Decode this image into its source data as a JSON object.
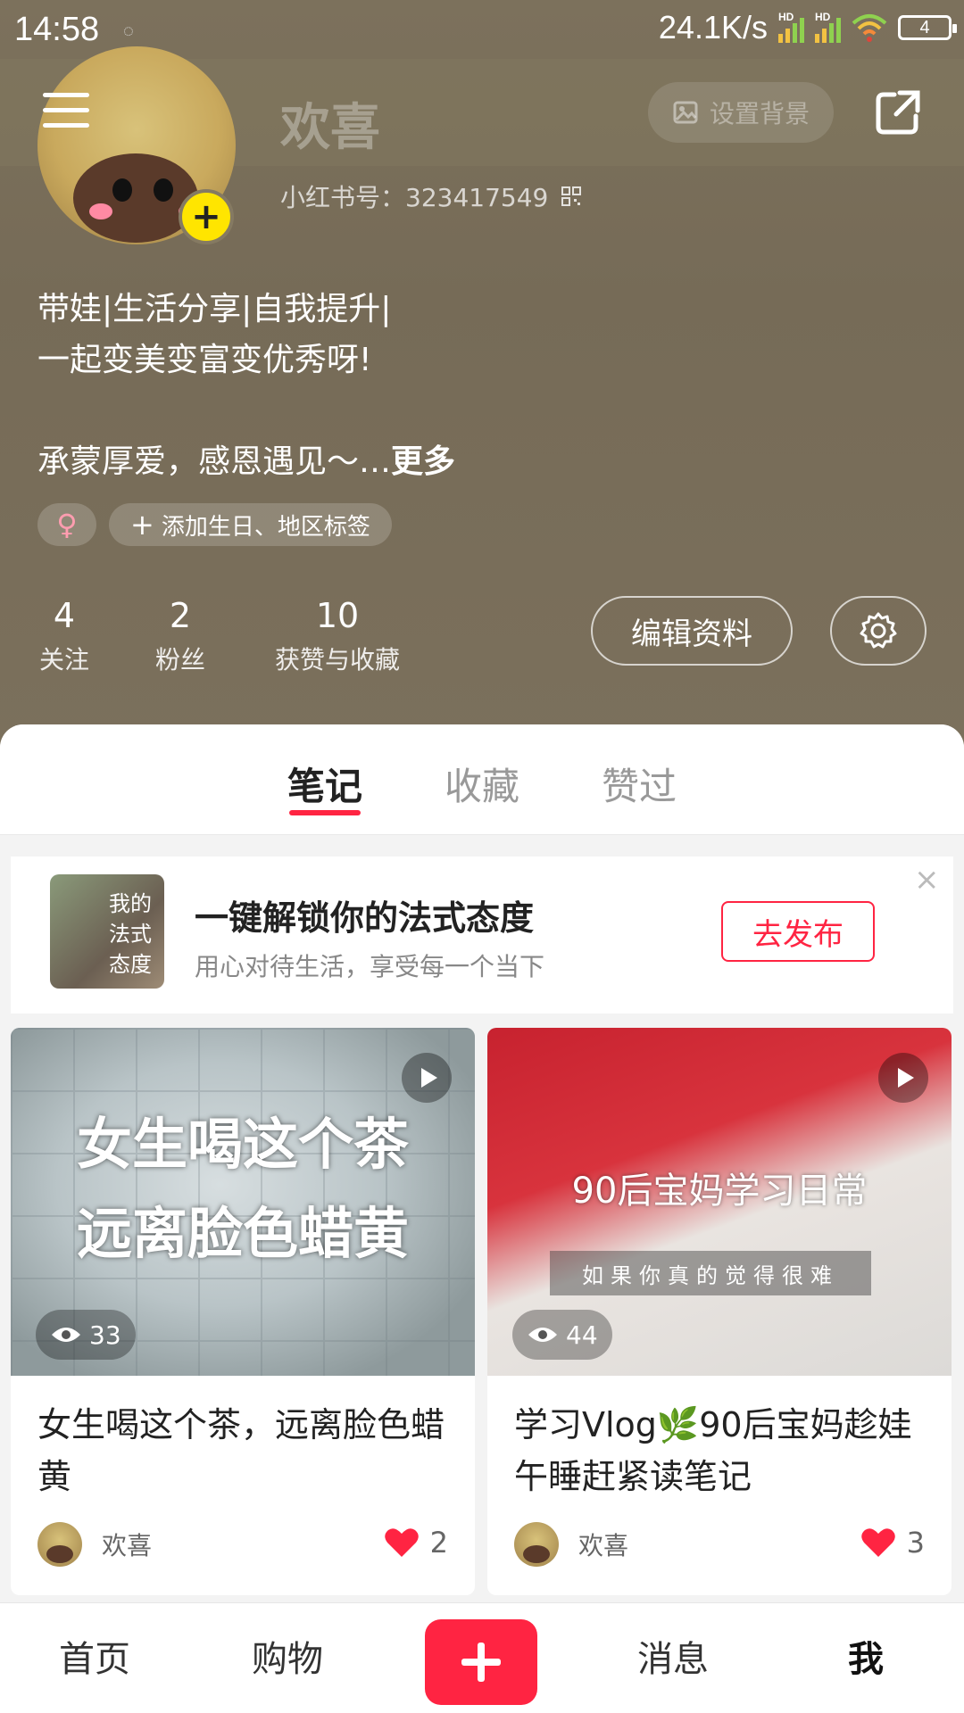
{
  "status_bar": {
    "time": "14:58",
    "net_speed": "24.1K/s",
    "hd_label": "HD",
    "battery": "4"
  },
  "profile": {
    "username": "欢喜",
    "set_background": "设置背景",
    "uid": "小红书号：323417549",
    "bio_line1": "带娃|生活分享|自我提升|",
    "bio_line2": "一起变美变富变优秀呀!",
    "bio_line3": "承蒙厚爱，感恩遇见～…",
    "bio_more": "更多",
    "gender_symbol": "♀",
    "add_tag": "添加生日、地区标签",
    "edit_profile": "编辑资料"
  },
  "stats": [
    {
      "num": "4",
      "label": "关注"
    },
    {
      "num": "2",
      "label": "粉丝"
    },
    {
      "num": "10",
      "label": "获赞与收藏"
    }
  ],
  "tabs": [
    "笔记",
    "收藏",
    "赞过"
  ],
  "promo": {
    "thumb_text": "我的\n法式\n态度",
    "title": "一键解锁你的法式态度",
    "subtitle": "用心对待生活，享受每一个当下",
    "button": "去发布",
    "close": "×"
  },
  "cards": [
    {
      "overlay_line1": "女生喝这个茶",
      "overlay_line2": "远离脸色蜡黄",
      "views": "33",
      "title": "女生喝这个茶，远离脸色蜡黄",
      "author": "欢喜",
      "likes": "2"
    },
    {
      "overlay_line1": "90后宝妈学习日常",
      "subtitle_text": "如果你真的觉得很难",
      "views": "44",
      "title": "学习Vlog🌿90后宝妈趁娃午睡赶紧读笔记",
      "author": "欢喜",
      "likes": "3"
    }
  ],
  "bottom_nav": [
    "首页",
    "购物",
    "消息",
    "我"
  ],
  "colors": {
    "accent": "#ff2442",
    "header_bg": "#7a6f5b",
    "avatar_badge": "#ffe500"
  }
}
